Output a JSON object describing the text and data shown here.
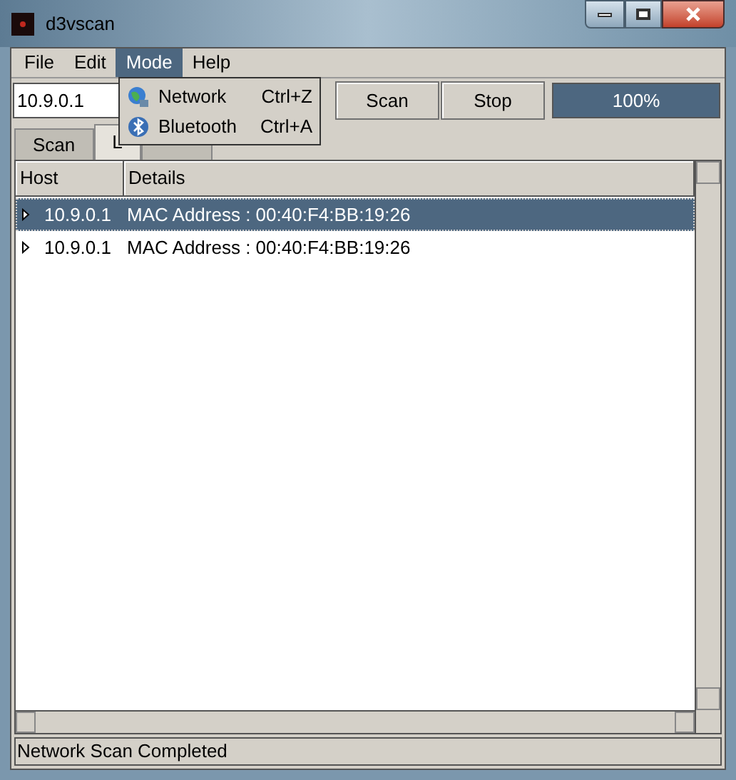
{
  "window": {
    "title": "d3vscan"
  },
  "menu": [
    {
      "label": "File",
      "selected": false
    },
    {
      "label": "Edit",
      "selected": false
    },
    {
      "label": "Mode",
      "selected": true
    },
    {
      "label": "Help",
      "selected": false
    }
  ],
  "mode_menu": [
    {
      "label": "Network",
      "shortcut": "Ctrl+Z",
      "kind": "network"
    },
    {
      "label": "Bluetooth",
      "shortcut": "Ctrl+A",
      "kind": "bluetooth"
    }
  ],
  "target": {
    "value": "10.9.0.1"
  },
  "buttons": [
    "Scan",
    "Stop"
  ],
  "progress": {
    "level": 1,
    "reading": "100%"
  },
  "tabs": [
    {
      "label": "Scan",
      "selected": false
    },
    {
      "label": "L",
      "selected": true
    },
    {
      "selected": false
    }
  ],
  "table": {
    "columns": [
      "Host",
      "Details"
    ],
    "rows": [
      {
        "host": "10.9.0.1",
        "details": "MAC Address : 00:40:F4:BB:19:26",
        "selected": true
      },
      {
        "host": "10.9.0.1",
        "details": "MAC Address : 00:40:F4:BB:19:26",
        "selected": false
      }
    ]
  },
  "status_bar": "Network Scan Completed"
}
